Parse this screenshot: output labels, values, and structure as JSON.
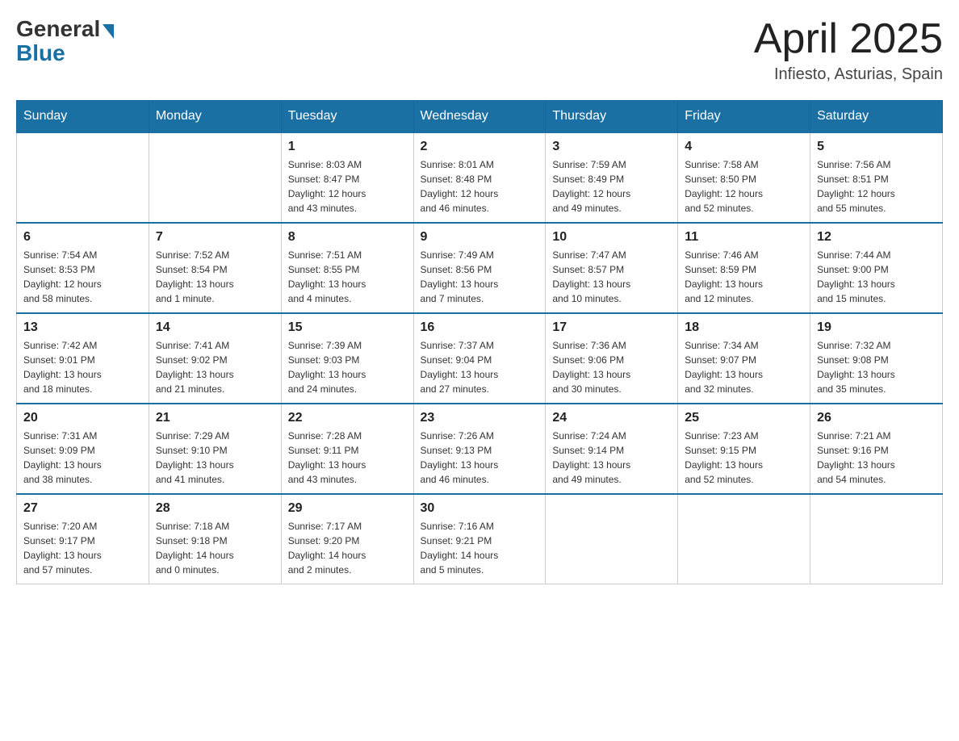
{
  "header": {
    "logo_general": "General",
    "logo_blue": "Blue",
    "month_title": "April 2025",
    "location": "Infiesto, Asturias, Spain"
  },
  "calendar": {
    "days_of_week": [
      "Sunday",
      "Monday",
      "Tuesday",
      "Wednesday",
      "Thursday",
      "Friday",
      "Saturday"
    ],
    "weeks": [
      [
        {
          "day": "",
          "info": ""
        },
        {
          "day": "",
          "info": ""
        },
        {
          "day": "1",
          "info": "Sunrise: 8:03 AM\nSunset: 8:47 PM\nDaylight: 12 hours\nand 43 minutes."
        },
        {
          "day": "2",
          "info": "Sunrise: 8:01 AM\nSunset: 8:48 PM\nDaylight: 12 hours\nand 46 minutes."
        },
        {
          "day": "3",
          "info": "Sunrise: 7:59 AM\nSunset: 8:49 PM\nDaylight: 12 hours\nand 49 minutes."
        },
        {
          "day": "4",
          "info": "Sunrise: 7:58 AM\nSunset: 8:50 PM\nDaylight: 12 hours\nand 52 minutes."
        },
        {
          "day": "5",
          "info": "Sunrise: 7:56 AM\nSunset: 8:51 PM\nDaylight: 12 hours\nand 55 minutes."
        }
      ],
      [
        {
          "day": "6",
          "info": "Sunrise: 7:54 AM\nSunset: 8:53 PM\nDaylight: 12 hours\nand 58 minutes."
        },
        {
          "day": "7",
          "info": "Sunrise: 7:52 AM\nSunset: 8:54 PM\nDaylight: 13 hours\nand 1 minute."
        },
        {
          "day": "8",
          "info": "Sunrise: 7:51 AM\nSunset: 8:55 PM\nDaylight: 13 hours\nand 4 minutes."
        },
        {
          "day": "9",
          "info": "Sunrise: 7:49 AM\nSunset: 8:56 PM\nDaylight: 13 hours\nand 7 minutes."
        },
        {
          "day": "10",
          "info": "Sunrise: 7:47 AM\nSunset: 8:57 PM\nDaylight: 13 hours\nand 10 minutes."
        },
        {
          "day": "11",
          "info": "Sunrise: 7:46 AM\nSunset: 8:59 PM\nDaylight: 13 hours\nand 12 minutes."
        },
        {
          "day": "12",
          "info": "Sunrise: 7:44 AM\nSunset: 9:00 PM\nDaylight: 13 hours\nand 15 minutes."
        }
      ],
      [
        {
          "day": "13",
          "info": "Sunrise: 7:42 AM\nSunset: 9:01 PM\nDaylight: 13 hours\nand 18 minutes."
        },
        {
          "day": "14",
          "info": "Sunrise: 7:41 AM\nSunset: 9:02 PM\nDaylight: 13 hours\nand 21 minutes."
        },
        {
          "day": "15",
          "info": "Sunrise: 7:39 AM\nSunset: 9:03 PM\nDaylight: 13 hours\nand 24 minutes."
        },
        {
          "day": "16",
          "info": "Sunrise: 7:37 AM\nSunset: 9:04 PM\nDaylight: 13 hours\nand 27 minutes."
        },
        {
          "day": "17",
          "info": "Sunrise: 7:36 AM\nSunset: 9:06 PM\nDaylight: 13 hours\nand 30 minutes."
        },
        {
          "day": "18",
          "info": "Sunrise: 7:34 AM\nSunset: 9:07 PM\nDaylight: 13 hours\nand 32 minutes."
        },
        {
          "day": "19",
          "info": "Sunrise: 7:32 AM\nSunset: 9:08 PM\nDaylight: 13 hours\nand 35 minutes."
        }
      ],
      [
        {
          "day": "20",
          "info": "Sunrise: 7:31 AM\nSunset: 9:09 PM\nDaylight: 13 hours\nand 38 minutes."
        },
        {
          "day": "21",
          "info": "Sunrise: 7:29 AM\nSunset: 9:10 PM\nDaylight: 13 hours\nand 41 minutes."
        },
        {
          "day": "22",
          "info": "Sunrise: 7:28 AM\nSunset: 9:11 PM\nDaylight: 13 hours\nand 43 minutes."
        },
        {
          "day": "23",
          "info": "Sunrise: 7:26 AM\nSunset: 9:13 PM\nDaylight: 13 hours\nand 46 minutes."
        },
        {
          "day": "24",
          "info": "Sunrise: 7:24 AM\nSunset: 9:14 PM\nDaylight: 13 hours\nand 49 minutes."
        },
        {
          "day": "25",
          "info": "Sunrise: 7:23 AM\nSunset: 9:15 PM\nDaylight: 13 hours\nand 52 minutes."
        },
        {
          "day": "26",
          "info": "Sunrise: 7:21 AM\nSunset: 9:16 PM\nDaylight: 13 hours\nand 54 minutes."
        }
      ],
      [
        {
          "day": "27",
          "info": "Sunrise: 7:20 AM\nSunset: 9:17 PM\nDaylight: 13 hours\nand 57 minutes."
        },
        {
          "day": "28",
          "info": "Sunrise: 7:18 AM\nSunset: 9:18 PM\nDaylight: 14 hours\nand 0 minutes."
        },
        {
          "day": "29",
          "info": "Sunrise: 7:17 AM\nSunset: 9:20 PM\nDaylight: 14 hours\nand 2 minutes."
        },
        {
          "day": "30",
          "info": "Sunrise: 7:16 AM\nSunset: 9:21 PM\nDaylight: 14 hours\nand 5 minutes."
        },
        {
          "day": "",
          "info": ""
        },
        {
          "day": "",
          "info": ""
        },
        {
          "day": "",
          "info": ""
        }
      ]
    ]
  }
}
